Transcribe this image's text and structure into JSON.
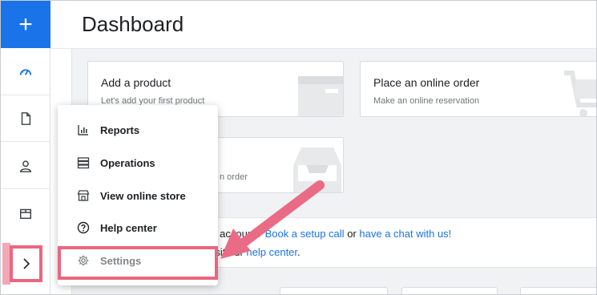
{
  "rail": {
    "add_label": "+",
    "items": [
      {
        "name": "dashboard",
        "icon": "speedometer-icon"
      },
      {
        "name": "documents",
        "icon": "document-icon"
      },
      {
        "name": "customers",
        "icon": "user-icon"
      },
      {
        "name": "store",
        "icon": "box-icon"
      }
    ],
    "expand_icon": "chevron-right-icon"
  },
  "header": {
    "title": "Dashboard"
  },
  "cards": [
    {
      "title": "Add a product",
      "subtitle": "Let's add your first product"
    },
    {
      "title": "Place an online order",
      "subtitle": "Make an online reservation"
    },
    {
      "title": "",
      "subtitle": "n order"
    }
  ],
  "help": {
    "line1_prefix": "ur account?",
    "link_setup": "Book a setup call",
    "or_text": "or",
    "link_chat": "have a chat with us!",
    "line2_prefix": "visit our",
    "link_help": "help center",
    "line2_suffix": "."
  },
  "menu": {
    "items": [
      {
        "label": "Reports",
        "icon": "bar-chart-icon"
      },
      {
        "label": "Operations",
        "icon": "server-icon"
      },
      {
        "label": "View online store",
        "icon": "storefront-icon"
      },
      {
        "label": "Help center",
        "icon": "question-circle-icon"
      },
      {
        "label": "Settings",
        "icon": "gear-icon"
      }
    ]
  },
  "colors": {
    "accent": "#1a73e8",
    "highlight": "#e9677f",
    "arrow": "#ea6b85"
  }
}
